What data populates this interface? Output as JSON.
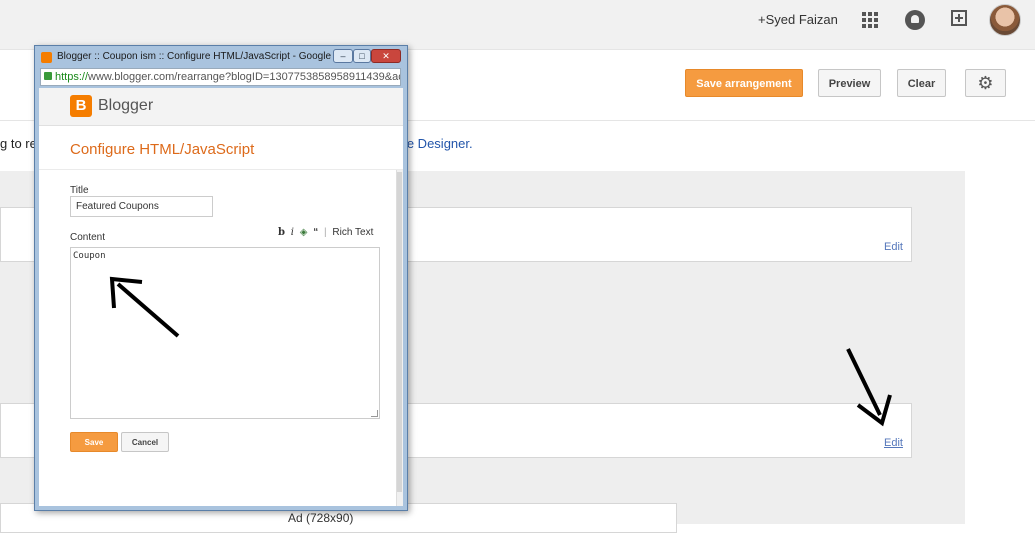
{
  "gbar": {
    "user_name": "+Syed Faizan",
    "icons": [
      "apps-icon",
      "bell-icon",
      "share-icon",
      "avatar"
    ]
  },
  "toolbar": {
    "save_arrangement": "Save arrangement",
    "preview": "Preview",
    "clear": "Clear",
    "settings_icon": "gear-icon"
  },
  "layout": {
    "info_text": "g to re",
    "info_link": "ate Designer.",
    "gadget_top_edit": "Edit",
    "gadget_mid_edit": "Edit",
    "ad_label": "Ad (728x90)"
  },
  "popup": {
    "window_title": "Blogger :: Coupon ism :: Configure HTML/JavaScript - Google Chrome",
    "url_scheme": "https://",
    "url_rest": "www.blogger.com/rearrange?blogID=1307753858958911439&ac",
    "brand": "Blogger",
    "heading": "Configure HTML/JavaScript",
    "title_label": "Title",
    "title_value": "Featured Coupons",
    "content_label": "Content",
    "rich_text": "Rich Text",
    "content_value": "Coupon",
    "save": "Save",
    "cancel": "Cancel"
  },
  "colors": {
    "accent_orange": "#f59b40",
    "heading_orange": "#dd6a1a",
    "link_blue": "#2255aa"
  }
}
